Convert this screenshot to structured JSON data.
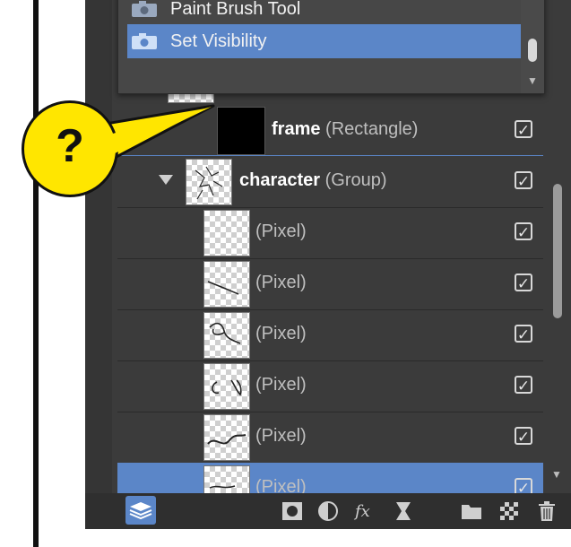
{
  "history": {
    "items": [
      {
        "label": "Paint Brush Tool",
        "icon": "camera-icon",
        "selected": false
      },
      {
        "label": "Set Visibility",
        "icon": "camera-icon",
        "selected": true
      }
    ]
  },
  "callout": {
    "symbol": "?"
  },
  "layers": [
    {
      "name": "frame",
      "type": "(Rectangle)",
      "visible": true,
      "thumbnail": "black"
    },
    {
      "name": "character",
      "type": "(Group)",
      "visible": true,
      "thumbnail": "sketch",
      "expanded": true
    },
    {
      "name": "",
      "type": "(Pixel)",
      "visible": true,
      "thumbnail": "transparent"
    },
    {
      "name": "",
      "type": "(Pixel)",
      "visible": true,
      "thumbnail": "stroke-1"
    },
    {
      "name": "",
      "type": "(Pixel)",
      "visible": true,
      "thumbnail": "stroke-2"
    },
    {
      "name": "",
      "type": "(Pixel)",
      "visible": true,
      "thumbnail": "stroke-3"
    },
    {
      "name": "",
      "type": "(Pixel)",
      "visible": true,
      "thumbnail": "stroke-4"
    },
    {
      "name": "",
      "type": "(Pixel)",
      "visible": true,
      "thumbnail": "stroke-5",
      "selected": true
    }
  ],
  "toolbar": {
    "items": [
      "layers-panel-icon",
      "mask-icon",
      "adjustment-icon",
      "fx-icon",
      "live-filter-icon",
      "folder-icon",
      "pixel-layer-icon",
      "trash-icon"
    ]
  },
  "colors": {
    "panel": "#3b3b3b",
    "selection": "#5b86c8",
    "callout": "#ffe600"
  }
}
